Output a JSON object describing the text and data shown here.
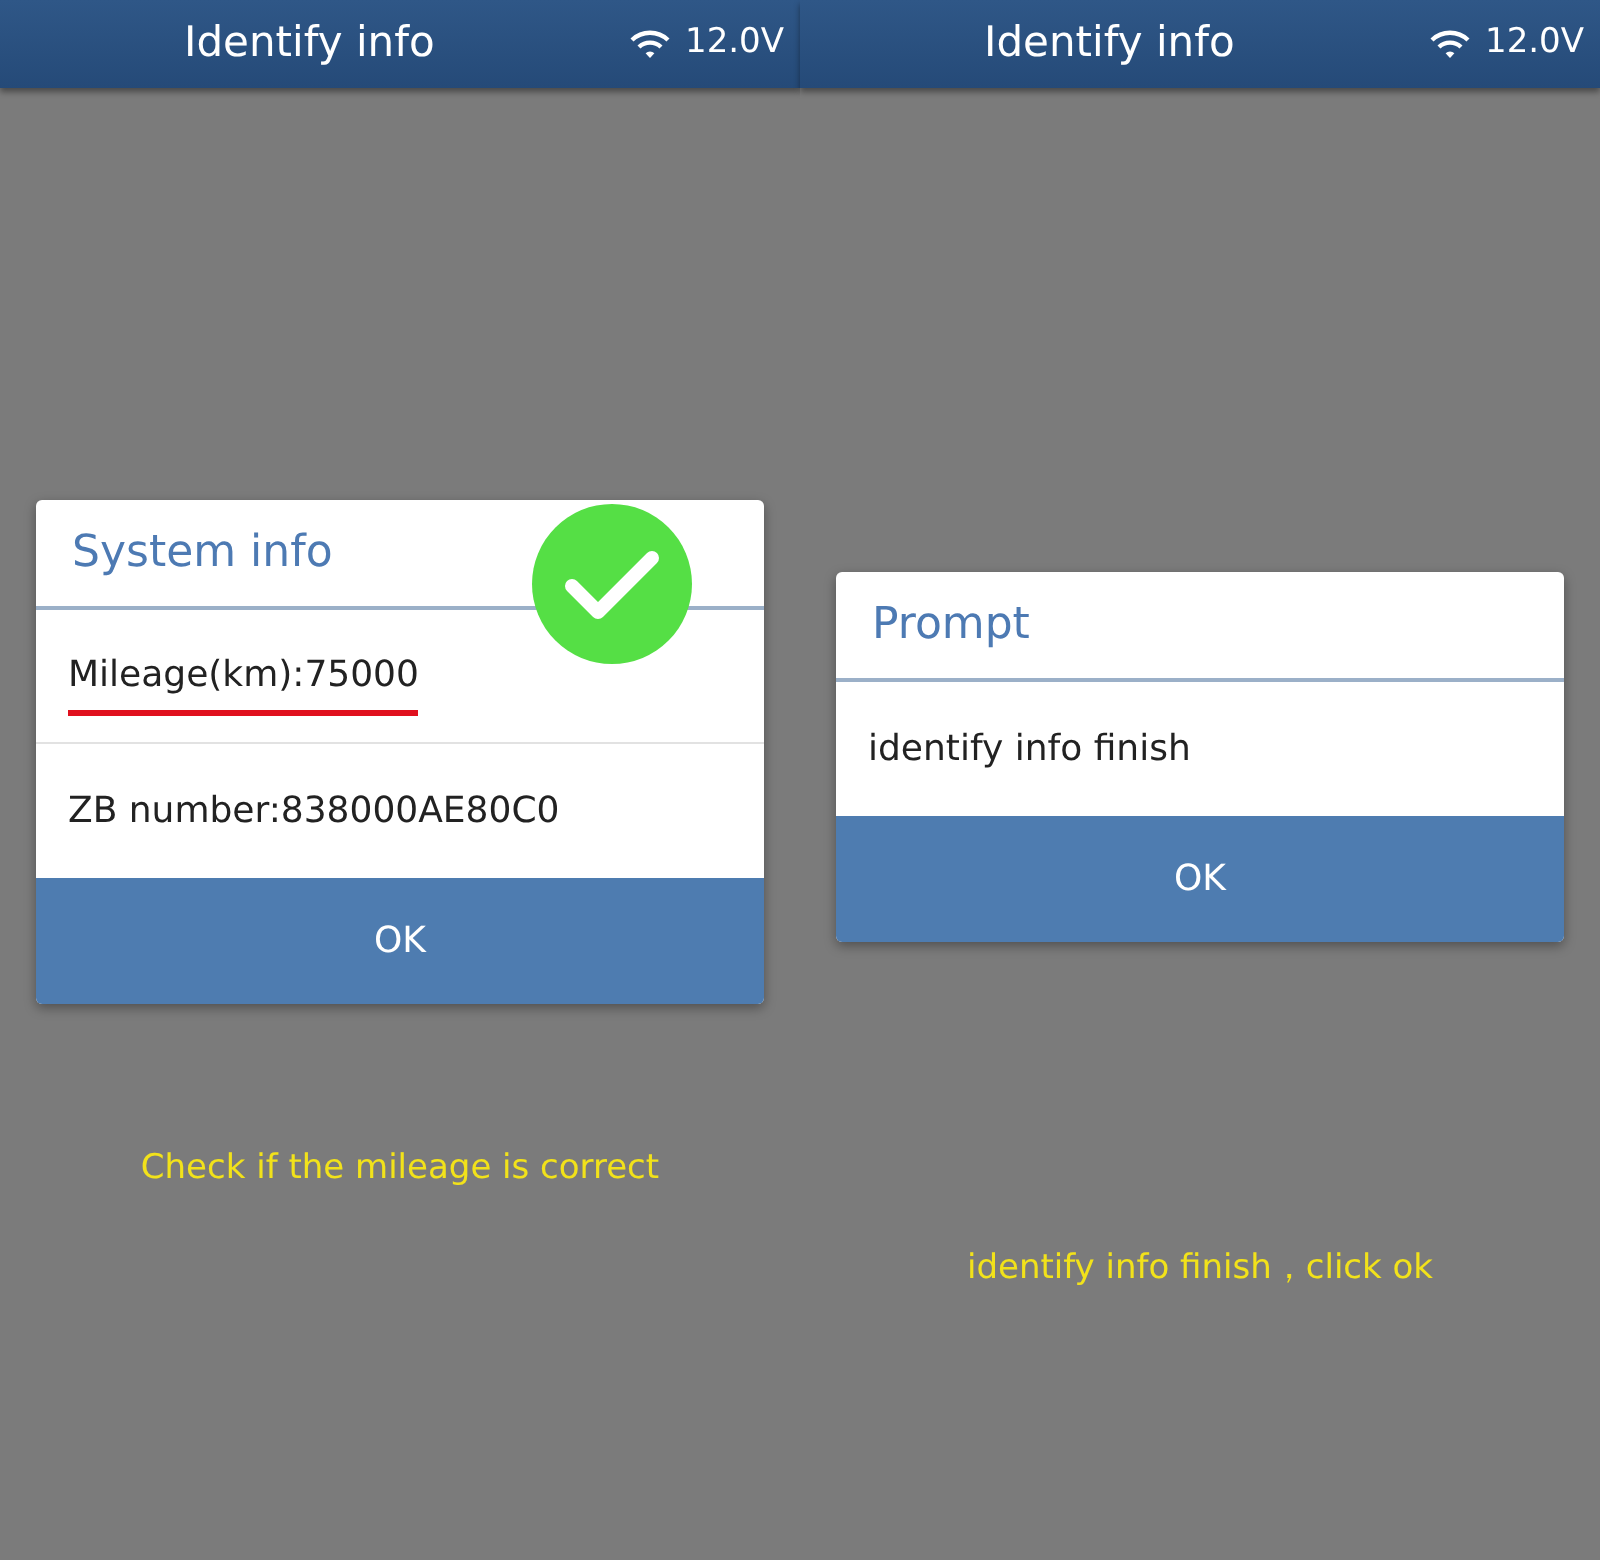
{
  "panels": [
    {
      "header": {
        "title": "Identify info",
        "voltage": "12.0V"
      },
      "dialog": {
        "title": "System info",
        "verified": true,
        "rows": [
          {
            "text": "Mileage(km):75000",
            "underlined": true
          },
          {
            "text": "ZB number:838000AE80C0",
            "underlined": false
          }
        ],
        "button": "OK"
      },
      "caption": "Check if the mileage is correct"
    },
    {
      "header": {
        "title": "Identify info",
        "voltage": "12.0V"
      },
      "dialog": {
        "title": "Prompt",
        "verified": false,
        "rows": [
          {
            "text": "identify info finish",
            "underlined": false
          }
        ],
        "button": "OK"
      },
      "caption": "identify info finish，click ok"
    }
  ]
}
